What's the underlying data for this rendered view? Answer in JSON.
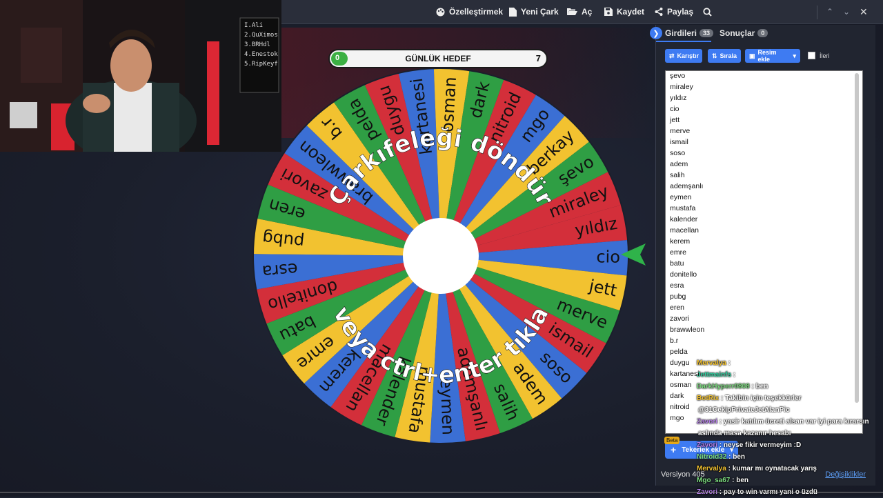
{
  "topbar": {
    "customize": "Özelleştirmek",
    "new_wheel": "Yeni Çark",
    "open": "Aç",
    "save": "Kaydet",
    "share": "Paylaş"
  },
  "webcam": {
    "board_lines": [
      "I.Ali",
      "2.QuXimos",
      "3.BRHdl",
      "4.Enestok",
      "5.RipKeyf"
    ],
    "colors": {
      "light": "#ff2a3a"
    }
  },
  "goal": {
    "title": "GÜNLÜK HEDEF",
    "current": "0",
    "target": "7",
    "progress_fraction": 0
  },
  "wheel": {
    "center_text_top": "Çarkıfeleği döndür",
    "center_text_bottom": "veya ctrl+enter tıkla",
    "segment_colors": [
      "#d32f3a",
      "#3b6fd4",
      "#f2c230",
      "#2f9e44"
    ],
    "segments": [
      "yıldız",
      "cio",
      "jett",
      "merve",
      "ismail",
      "soso",
      "adem",
      "salih",
      "ademşanlı",
      "eymen",
      "mustafa",
      "kalender",
      "macellan",
      "kerem",
      "emre",
      "batu",
      "donitello",
      "esra",
      "pubg",
      "eren",
      "zavori",
      "brawwleon",
      "b.r",
      "pelda",
      "duygu",
      "kartanesi",
      "osman",
      "dark",
      "nitroid",
      "mgo",
      "berkay",
      "şevo",
      "miraley"
    ]
  },
  "panel": {
    "tab_entries": "Girdileri",
    "entries_count": "33",
    "tab_results": "Sonuçlar",
    "results_count": "0",
    "shuffle": "Karıştır",
    "sort": "Sırala",
    "add_image": "Resim ekle",
    "advanced": "İleri",
    "entries": [
      "şevo",
      "miraley",
      "yıldız",
      "cio",
      "jett",
      "merve",
      "ismail",
      "soso",
      "adem",
      "salih",
      "ademşanlı",
      "eymen",
      "mustafa",
      "kalender",
      "macellan",
      "kerem",
      "emre",
      "batu",
      "donitello",
      "esra",
      "pubg",
      "eren",
      "zavori",
      "brawwleon",
      "b.r",
      "pelda",
      "duygu",
      "kartanesi",
      "osman",
      "dark",
      "nitroid",
      "mgo"
    ],
    "beta": "Beta",
    "add_wheels": "Tekerlek ekle",
    "version": "Versiyon 405",
    "changes": "Değişiklikler"
  },
  "chat": [
    {
      "user": "Mervalya",
      "msg": ":",
      "color": "#f2c230"
    },
    {
      "user": "Jettmainfs",
      "msg": ":",
      "color": "#2fd1a0"
    },
    {
      "user": "DarkHyperr0808",
      "msg": ": ben",
      "color": "#7ee081"
    },
    {
      "user": "BotRix",
      "msg": ": Takibin için teşekkürler",
      "color": "#f2c230"
    },
    {
      "user": "",
      "msg": "@31CekipPrivateJetAlanPic",
      "color": "#ffffff"
    },
    {
      "user": "Zavori",
      "msg": ": yasir katılım ücreti alsan var iyi para kırarsın",
      "color": "#b47ee8"
    },
    {
      "user": "",
      "msg": "aslında masa kazanır hesabı",
      "color": "#ffffff"
    },
    {
      "user": "Zavori",
      "msg": ": neyse fikir vermeyim :D",
      "color": "#b47ee8"
    },
    {
      "user": "Nitroid32",
      "msg": ": ben",
      "color": "#7ee081"
    },
    {
      "user": "Mervalya",
      "msg": ": kumar mı oynatacak yarış",
      "color": "#f2c230"
    },
    {
      "user": "Mgo_sa67",
      "msg": ": ben",
      "color": "#7ee081"
    },
    {
      "user": "Zavori",
      "msg": ": pay to win varmı yani o üzdü",
      "color": "#b47ee8"
    }
  ]
}
